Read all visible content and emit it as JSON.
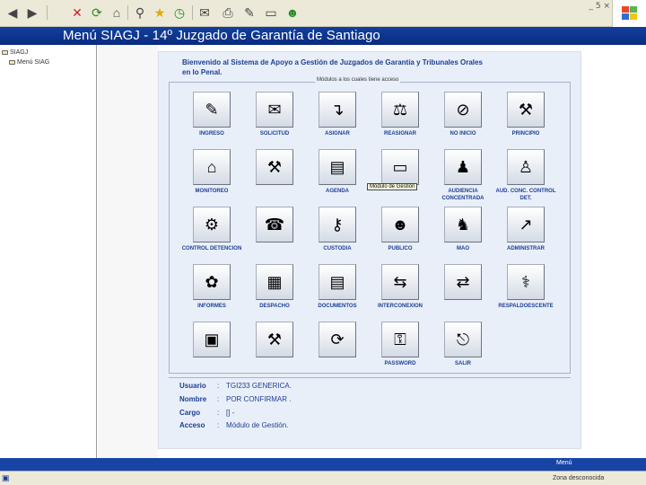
{
  "window": {
    "title": "Menú SIAGJ - 14º Juzgado de Garantía de Santiago"
  },
  "toolbar": {
    "icons": [
      "back-icon",
      "forward-icon",
      "stop-icon",
      "refresh-icon",
      "home-icon",
      "search-icon",
      "favorites-icon",
      "history-icon",
      "mail-icon",
      "print-icon",
      "edit-icon",
      "discuss-icon",
      "messenger-icon"
    ],
    "window_controls": [
      "_",
      "5",
      "×"
    ]
  },
  "tree": {
    "items": [
      {
        "label": "SIAGJ"
      },
      {
        "label": "Menú SIAG"
      }
    ]
  },
  "content": {
    "welcome": "Bienvenido al Sistema de Apoyo a Gestión de Juzgados de Garantía y Tribunales Orales en lo Penal.",
    "legend": "Módulos a los cuales tiene acceso",
    "tooltip": "Módulo de Gestión",
    "modules": [
      {
        "label": "INGRESO",
        "icon": "✎"
      },
      {
        "label": "SOLICITUD",
        "icon": "✉"
      },
      {
        "label": "ASIGNAR",
        "icon": "↴"
      },
      {
        "label": "REASIGNAR",
        "icon": "⚖"
      },
      {
        "label": "NO INICIO",
        "icon": "⊘"
      },
      {
        "label": "PRINCIPIO",
        "icon": "⚒"
      },
      {
        "label": "MONITOREO",
        "icon": "⌂"
      },
      {
        "label": "",
        "icon": "⚒"
      },
      {
        "label": "AGENDA",
        "icon": "▤"
      },
      {
        "label": "",
        "icon": "▭"
      },
      {
        "label": "AUDIENCIA CONCENTRADA",
        "icon": "♟"
      },
      {
        "label": "AUD. CONC. CONTROL DET.",
        "icon": "♙"
      },
      {
        "label": "CONTROL DETENCION",
        "icon": "⚙"
      },
      {
        "label": "",
        "icon": "☎"
      },
      {
        "label": "CUSTODIA",
        "icon": "⚷"
      },
      {
        "label": "PUBLICO",
        "icon": "☻"
      },
      {
        "label": "MAO",
        "icon": "♞"
      },
      {
        "label": "ADMINISTRAR",
        "icon": "↗"
      },
      {
        "label": "INFORMES",
        "icon": "✿"
      },
      {
        "label": "DESPACHO",
        "icon": "▦"
      },
      {
        "label": "DOCUMENTOS",
        "icon": "▤"
      },
      {
        "label": "INTERCONEXION",
        "icon": "⇆"
      },
      {
        "label": "",
        "icon": "⇄"
      },
      {
        "label": "RESPALDOESCENTE",
        "icon": "⚕"
      },
      {
        "label": "",
        "icon": "▣"
      },
      {
        "label": "",
        "icon": "⚒"
      },
      {
        "label": "",
        "icon": "⟳"
      },
      {
        "label": "PASSWORD",
        "icon": "⚿"
      },
      {
        "label": "SALIR",
        "icon": "⎋"
      }
    ],
    "info": {
      "usuario_label": "Usuario",
      "usuario_value": "TGI233 GENERICA.",
      "nombre_label": "Nombre",
      "nombre_value": "POR CONFIRMAR .",
      "cargo_label": "Cargo",
      "cargo_value": "[] -",
      "acceso_label": "Acceso",
      "acceso_value": "Módulo de Gestión."
    }
  },
  "status": {
    "menu_text": "Menú",
    "zone_text": "Zona desconocida"
  },
  "colors": {
    "title_bar": "#0a2c7f",
    "label_text": "#1c3f93",
    "panel_bg": "#e9eff9"
  }
}
